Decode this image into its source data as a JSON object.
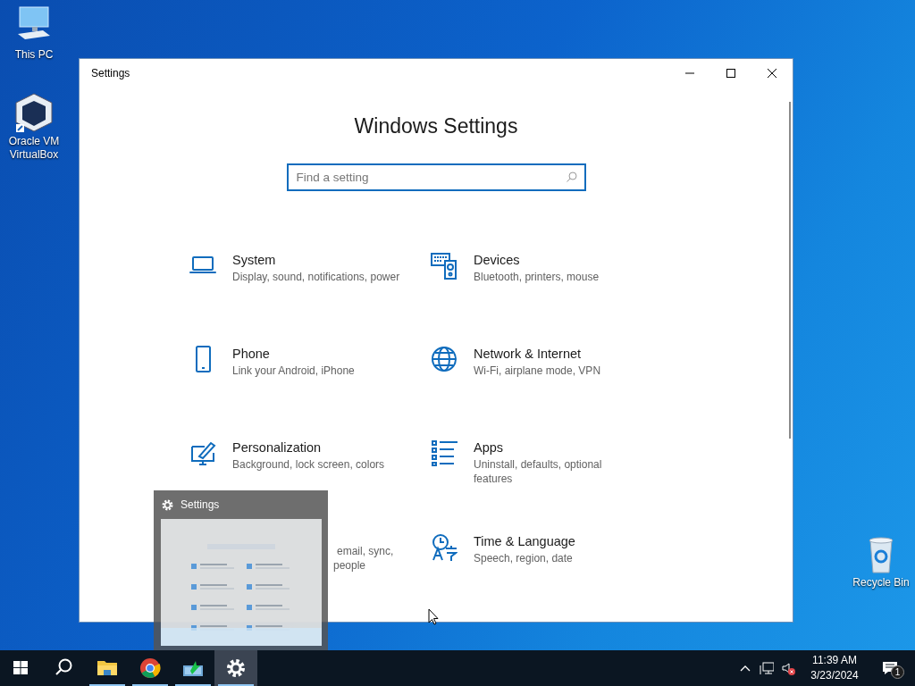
{
  "desktop_icons": [
    {
      "kind": "pc",
      "label": "This PC"
    },
    {
      "kind": "virtualbox",
      "label": "Oracle VM VirtualBox"
    },
    {
      "kind": "recycle-bin",
      "label": "Recycle Bin"
    }
  ],
  "window": {
    "title": "Settings",
    "heading": "Windows Settings",
    "search": {
      "placeholder": "Find a setting"
    },
    "categories": [
      {
        "kind": "laptop",
        "title": "System",
        "description": "Display, sound, notifications, power"
      },
      {
        "kind": "devices",
        "title": "Devices",
        "description": "Bluetooth, printers, mouse"
      },
      {
        "kind": "phone",
        "title": "Phone",
        "description": "Link your Android, iPhone"
      },
      {
        "kind": "globe",
        "title": "Network & Internet",
        "description": "Wi-Fi, airplane mode, VPN"
      },
      {
        "kind": "brush",
        "title": "Personalization",
        "description": "Background, lock screen, colors"
      },
      {
        "kind": "apps",
        "title": "Apps",
        "description": "Uninstall, defaults, optional features"
      },
      {
        "kind": "partial",
        "visible_lines": [
          "email, sync,",
          "people"
        ]
      },
      {
        "kind": "time",
        "title": "Time & Language",
        "description": "Speech, region, date"
      }
    ]
  },
  "thumbnail": {
    "title": "Settings"
  },
  "taskbar": {
    "items": [
      {
        "kind": "start",
        "running": false,
        "selected": false
      },
      {
        "kind": "search",
        "running": false,
        "selected": false
      },
      {
        "kind": "explorer",
        "running": true,
        "selected": false
      },
      {
        "kind": "chrome",
        "running": true,
        "selected": false
      },
      {
        "kind": "monitor",
        "running": true,
        "selected": false
      },
      {
        "kind": "settings",
        "running": true,
        "selected": true
      }
    ],
    "tray": {
      "volume_muted": true,
      "time": "11:39 AM",
      "date": "3/23/2024",
      "notification_count": "1"
    }
  }
}
